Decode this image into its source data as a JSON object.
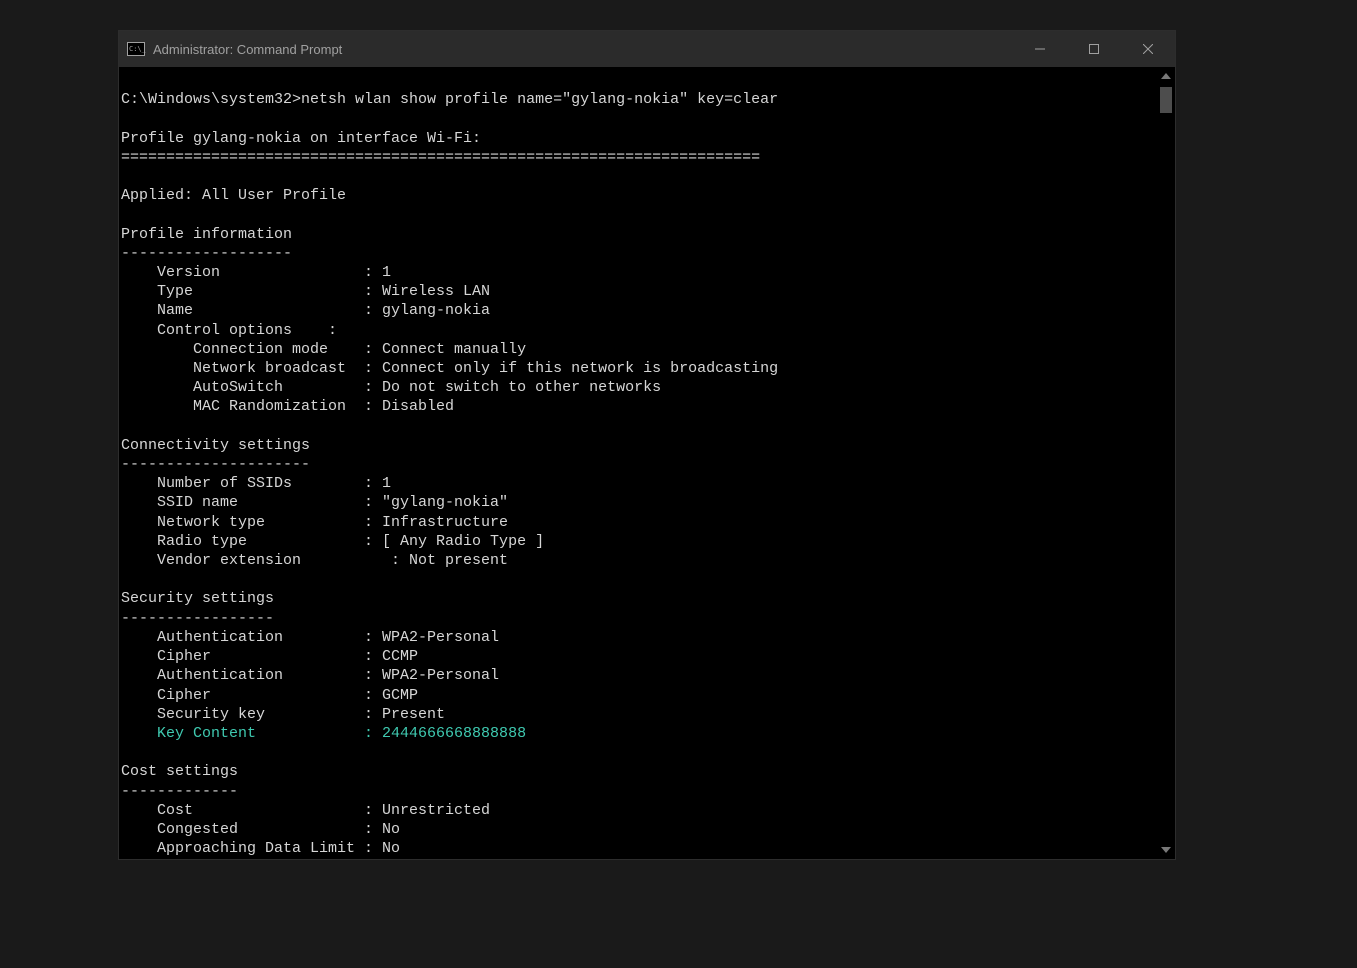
{
  "titlebar": {
    "title": "Administrator: Command Prompt"
  },
  "prompt": {
    "path": "C:\\Windows\\system32>",
    "command": "netsh wlan show profile name=\"gylang-nokia\" key=clear"
  },
  "output": {
    "header_line": "Profile gylang-nokia on interface Wi-Fi:",
    "header_sep": "=======================================================================",
    "applied": "Applied: All User Profile",
    "sections": {
      "profile_info": {
        "title": "Profile information",
        "sep": "-------------------",
        "rows": [
          {
            "label": "Version",
            "value": "1"
          },
          {
            "label": "Type",
            "value": "Wireless LAN"
          },
          {
            "label": "Name",
            "value": "gylang-nokia"
          },
          {
            "label": "Control options",
            "value": ""
          },
          {
            "label": "Connection mode",
            "value": "Connect manually",
            "indent": 2
          },
          {
            "label": "Network broadcast",
            "value": "Connect only if this network is broadcasting",
            "indent": 2
          },
          {
            "label": "AutoSwitch",
            "value": "Do not switch to other networks",
            "indent": 2
          },
          {
            "label": "MAC Randomization",
            "value": "Disabled",
            "indent": 2
          }
        ]
      },
      "connectivity": {
        "title": "Connectivity settings",
        "sep": "---------------------",
        "rows": [
          {
            "label": "Number of SSIDs",
            "value": "1"
          },
          {
            "label": "SSID name",
            "value": "\"gylang-nokia\""
          },
          {
            "label": "Network type",
            "value": "Infrastructure"
          },
          {
            "label": "Radio type",
            "value": "[ Any Radio Type ]"
          },
          {
            "label": "Vendor extension",
            "value": "Not present",
            "alt_pad": true
          }
        ]
      },
      "security": {
        "title": "Security settings",
        "sep": "-----------------",
        "rows": [
          {
            "label": "Authentication",
            "value": "WPA2-Personal"
          },
          {
            "label": "Cipher",
            "value": "CCMP"
          },
          {
            "label": "Authentication",
            "value": "WPA2-Personal"
          },
          {
            "label": "Cipher",
            "value": "GCMP"
          },
          {
            "label": "Security key",
            "value": "Present"
          },
          {
            "label": "Key Content",
            "value": "2444666668888888",
            "highlight": true
          }
        ]
      },
      "cost": {
        "title": "Cost settings",
        "sep": "-------------",
        "rows": [
          {
            "label": "Cost",
            "value": "Unrestricted"
          },
          {
            "label": "Congested",
            "value": "No"
          },
          {
            "label": "Approaching Data Limit",
            "value": "No"
          }
        ]
      }
    }
  }
}
